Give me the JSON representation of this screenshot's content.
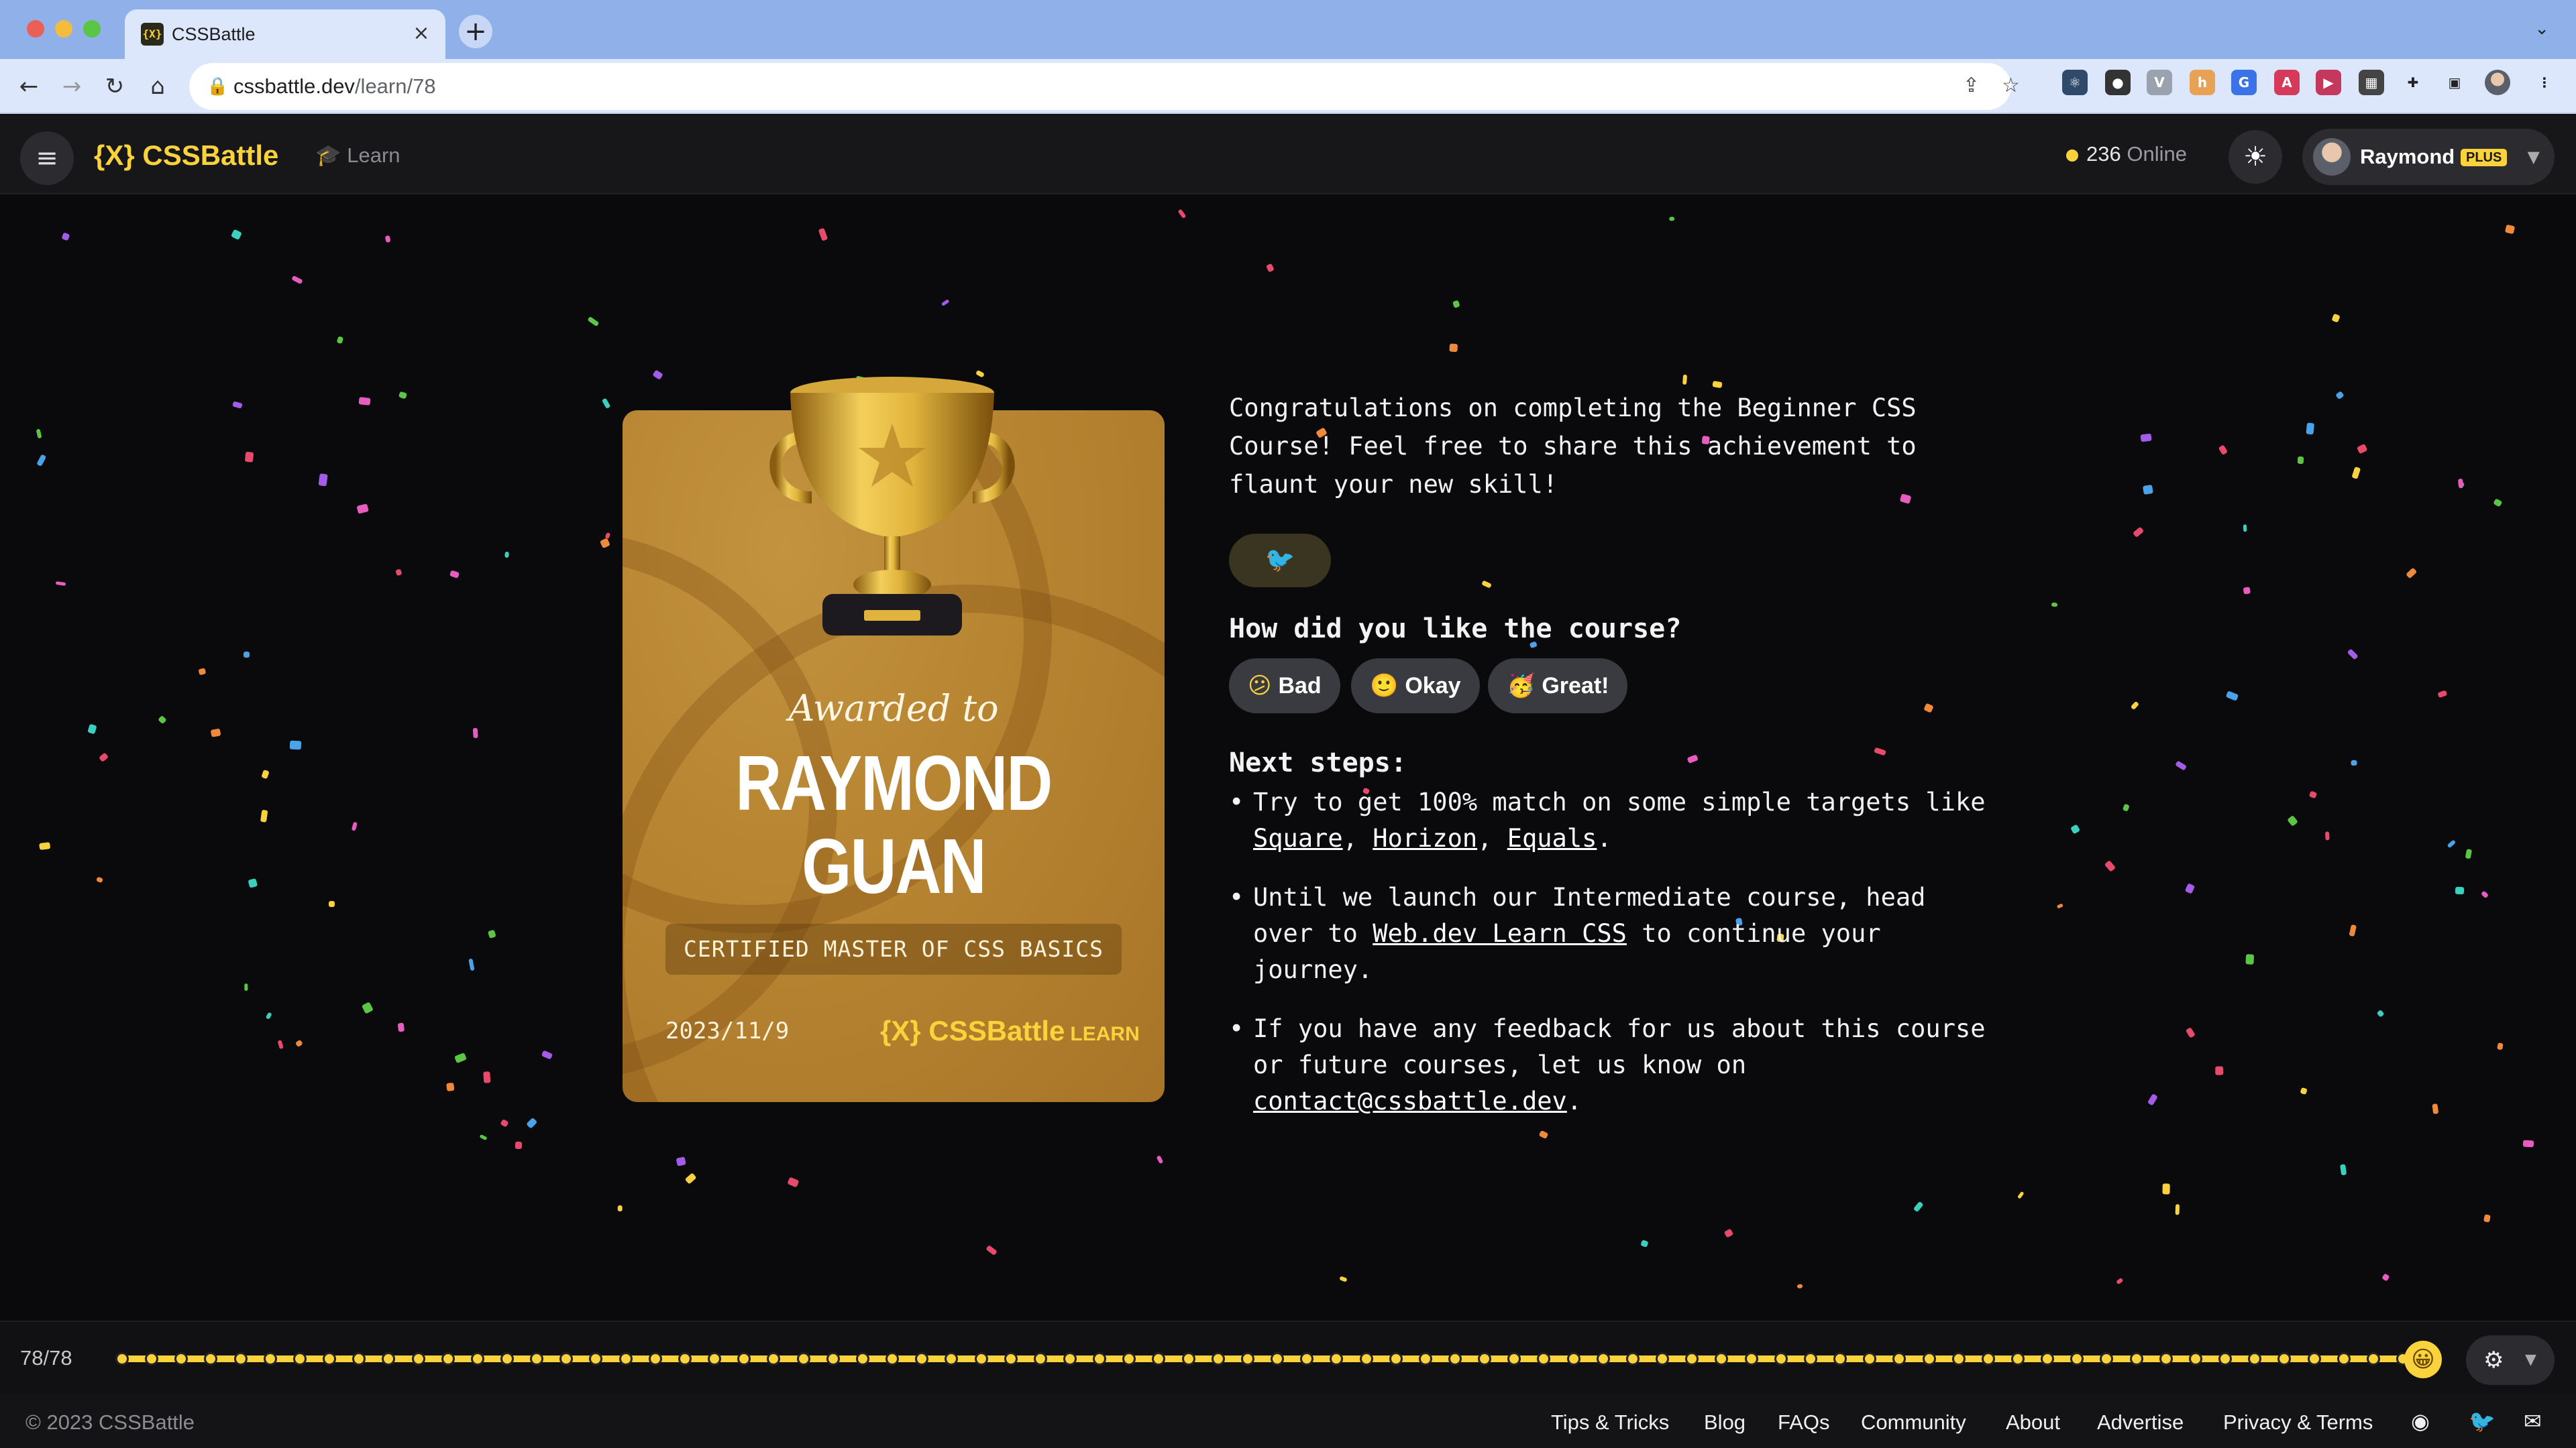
{
  "browser": {
    "tab_title": "CSSBattle",
    "tab_favicon": "{X}",
    "url_host": "cssbattle.dev",
    "url_path": "/learn/78"
  },
  "header": {
    "logo": "{X} CSSBattle",
    "learn_link": "Learn",
    "online_count": "236",
    "online_label": "Online",
    "user_name": "Raymond",
    "plan_badge": "PLUS"
  },
  "certificate": {
    "awarded_to": "Awarded to",
    "recipient_line1": "RAYMOND",
    "recipient_line2": "GUAN",
    "title": "CERTIFIED MASTER OF CSS BASICS",
    "date": "2023/11/9",
    "brand": "{X} CSSBattle",
    "brand_suffix": "LEARN"
  },
  "content": {
    "congrats": "Congratulations on completing the Beginner CSS Course! Feel free to share this achievement to flaunt your new skill!",
    "feedback_title": "How did you like the course?",
    "ratings": [
      {
        "emoji": "😕",
        "label": "Bad"
      },
      {
        "emoji": "🙂",
        "label": "Okay"
      },
      {
        "emoji": "🥳",
        "label": "Great!"
      }
    ],
    "next_steps_title": "Next steps:",
    "step1_prefix": "Try to get 100% match on some simple targets like",
    "step1_links": [
      "Square",
      "Horizon",
      "Equals"
    ],
    "step2_prefix": "Until we launch our Intermediate course, head over to",
    "step2_link": "Web.dev Learn CSS",
    "step2_suffix": "to continue your journey.",
    "step3_prefix": "If you have any feedback for us about this course or future courses, let us know on",
    "step3_link": "contact@cssbattle.dev"
  },
  "progress": {
    "counter": "78/78",
    "completed": 78,
    "total": 78
  },
  "footer": {
    "copyright": "© 2023 CSSBattle",
    "links": [
      "Tips & Tricks",
      "Blog",
      "FAQs",
      "Community",
      "About",
      "Advertise",
      "Privacy & Terms"
    ]
  },
  "colors": {
    "accent": "#f9d23c",
    "background": "#0a0a0c",
    "card_gold": "#b88632"
  },
  "icons": [
    "menu-icon",
    "learn-cap-icon",
    "sun-icon",
    "twitter-icon",
    "gear-icon",
    "discord-icon",
    "mail-icon"
  ]
}
